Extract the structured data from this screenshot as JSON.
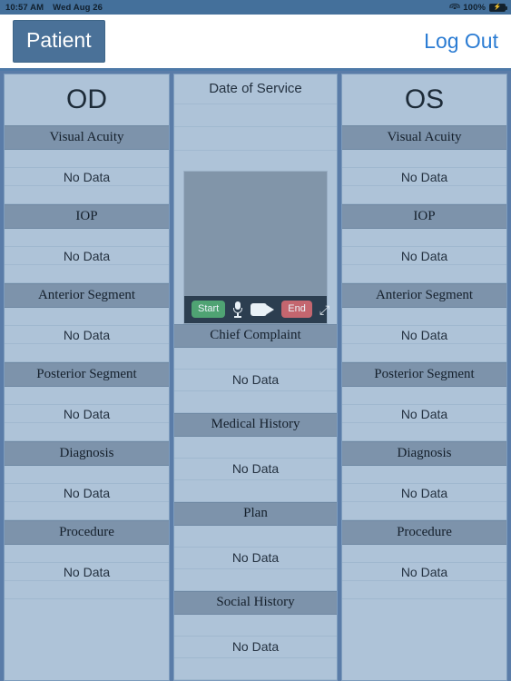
{
  "statusbar": {
    "time": "10:57 AM",
    "date": "Wed Aug 26",
    "wifi_icon": "wifi-icon",
    "battery_percent": "100%",
    "battery_icon": "battery-full-charging-icon"
  },
  "navbar": {
    "patient_button": "Patient",
    "logout_link": "Log Out"
  },
  "colors": {
    "page_background": "#5a7ca8",
    "column_background": "#aec3d8",
    "section_header": "#7d93ab",
    "accent_blue": "#2b7cd3",
    "patient_button": "#4a7198",
    "start_green": "#4fa373",
    "end_red": "#c4666f",
    "video_bar": "#2c3e50",
    "video_stage": "#8195a9"
  },
  "od_column": {
    "title": "OD",
    "sections": [
      {
        "header": "Visual Acuity",
        "value": "No Data"
      },
      {
        "header": "IOP",
        "value": "No Data"
      },
      {
        "header": "Anterior Segment",
        "value": "No Data"
      },
      {
        "header": "Posterior Segment",
        "value": "No Data"
      },
      {
        "header": "Diagnosis",
        "value": "No Data"
      },
      {
        "header": "Procedure",
        "value": "No Data"
      }
    ]
  },
  "os_column": {
    "title": "OS",
    "sections": [
      {
        "header": "Visual Acuity",
        "value": "No Data"
      },
      {
        "header": "IOP",
        "value": "No Data"
      },
      {
        "header": "Anterior Segment",
        "value": "No Data"
      },
      {
        "header": "Posterior Segment",
        "value": "No Data"
      },
      {
        "header": "Diagnosis",
        "value": "No Data"
      },
      {
        "header": "Procedure",
        "value": "No Data"
      }
    ]
  },
  "middle_column": {
    "title": "Date of Service",
    "date_value": "",
    "video": {
      "start_label": "Start",
      "end_label": "End",
      "mic_icon": "microphone-icon",
      "camera_icon": "video-camera-icon",
      "expand_icon": "expand-diagonal-icon"
    },
    "sections": [
      {
        "header": "Chief Complaint",
        "value": "No Data"
      },
      {
        "header": "Medical History",
        "value": "No Data"
      },
      {
        "header": "Plan",
        "value": "No Data"
      },
      {
        "header": "Social History",
        "value": "No Data"
      }
    ]
  }
}
